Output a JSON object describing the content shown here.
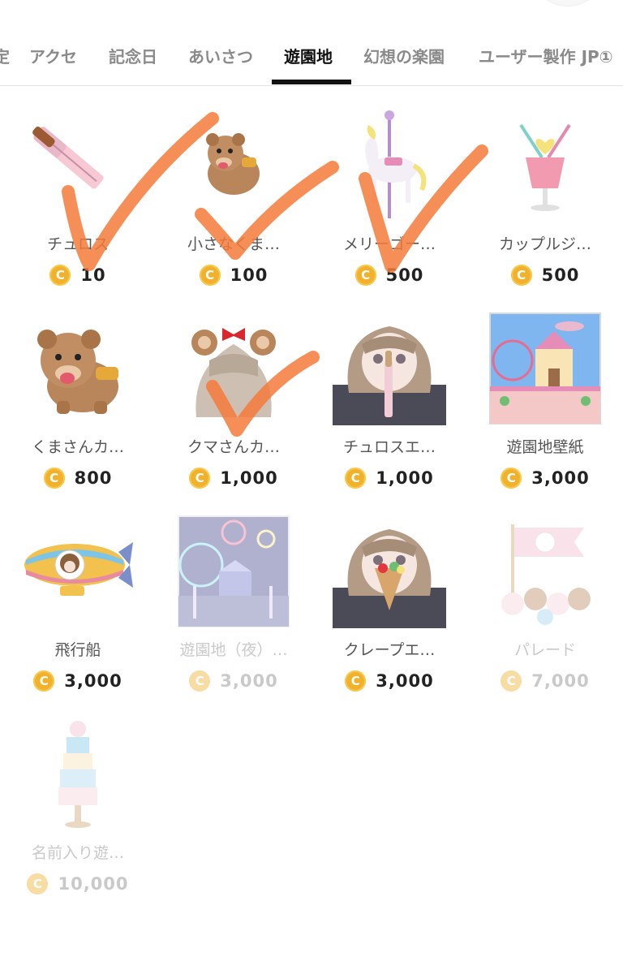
{
  "tabs": [
    {
      "label": "定",
      "name": "tab-partial"
    },
    {
      "label": "アクセ",
      "name": "tab-accessories"
    },
    {
      "label": "記念日",
      "name": "tab-anniversary"
    },
    {
      "label": "あいさつ",
      "name": "tab-greetings"
    },
    {
      "label": "遊園地",
      "name": "tab-amusement-park"
    },
    {
      "label": "幻想の楽園",
      "name": "tab-fantasy-paradise"
    },
    {
      "label": "ユーザー製作 JP①",
      "name": "tab-user-made-jp"
    }
  ],
  "active_tab": "遊園地",
  "coin_symbol": "C",
  "colors": {
    "coin": "#f2b12a",
    "check_mark": "#f47a3a",
    "active_tab": "#111111"
  },
  "items": [
    {
      "name": "チュロス",
      "price": "10",
      "icon": "churro-icon"
    },
    {
      "name": "小さなくま…",
      "price": "100",
      "icon": "small-bear-icon"
    },
    {
      "name": "メリーゴー…",
      "price": "500",
      "icon": "carousel-horse-icon"
    },
    {
      "name": "カップルジ…",
      "price": "500",
      "icon": "couple-juice-icon"
    },
    {
      "name": "くまさんカ…",
      "price": "800",
      "icon": "bear-icon"
    },
    {
      "name": "クマさんカ…",
      "price": "1,000",
      "icon": "bear-headband-icon"
    },
    {
      "name": "チュロスエ…",
      "price": "1,000",
      "icon": "churro-girl-icon"
    },
    {
      "name": "遊園地壁紙",
      "price": "3,000",
      "icon": "park-wallpaper-icon"
    },
    {
      "name": "飛行船",
      "price": "3,000",
      "icon": "airship-icon"
    },
    {
      "name": "遊園地（夜）…",
      "price": "3,000",
      "icon": "night-park-icon"
    },
    {
      "name": "クレープエ…",
      "price": "3,000",
      "icon": "crepe-girl-icon"
    },
    {
      "name": "パレード",
      "price": "7,000",
      "icon": "parade-icon"
    },
    {
      "name": "名前入り遊…",
      "price": "10,000",
      "icon": "named-tower-icon"
    }
  ]
}
